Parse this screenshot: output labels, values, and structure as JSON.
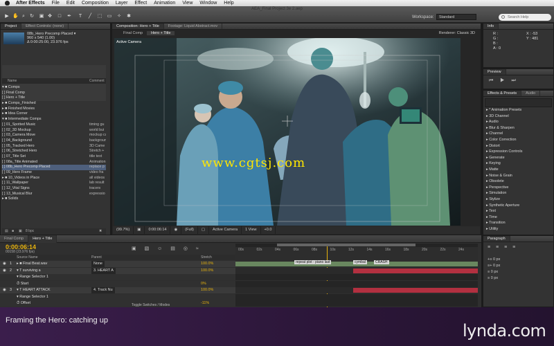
{
  "menubar": {
    "app_name": "After Effects",
    "items": [
      "File",
      "Edit",
      "Composition",
      "Layer",
      "Effect",
      "Animation",
      "View",
      "Window",
      "Help"
    ],
    "window_title": "AEA_Final Project 3e 2.aep"
  },
  "toolbar": {
    "workspace_label": "Workspace:",
    "workspace_value": "Standard",
    "search_placeholder": "Search Help"
  },
  "project_panel": {
    "tabs": [
      "Project",
      "Effect Controls: (none)"
    ],
    "selected_name": "08b_Hero Precomp Placed ▾",
    "selected_dims": "960 x 540 (1.00)",
    "selected_duration": "Δ 0:00:25:00, 23.976 fps",
    "col_name": "Name",
    "col_comment": "Comment",
    "items": [
      {
        "label": "▾ ■ Comps",
        "comment": ""
      },
      {
        "label": "      [ ] Final Comp",
        "comment": ""
      },
      {
        "label": "      [ ] Hero + Title",
        "comment": ""
      },
      {
        "label": "▸ ■ Comps_Finished",
        "comment": ""
      },
      {
        "label": "▸ ■ Finished Movies",
        "comment": ""
      },
      {
        "label": "▸ ■ Idea Corner",
        "comment": ""
      },
      {
        "label": "▾ ■ Intermediate Comps",
        "comment": ""
      },
      {
        "label": "      [ ] 01_Spotted Music",
        "comment": "timing gu"
      },
      {
        "label": "      [ ] 02_3D Mockup",
        "comment": "world bui"
      },
      {
        "label": "      [ ] 03_Camera Move",
        "comment": "mockup ca"
      },
      {
        "label": "      [ ] 04_Background",
        "comment": "backgroun"
      },
      {
        "label": "      [ ] 05_Tracked Hero",
        "comment": "3D Came"
      },
      {
        "label": "      [ ] 06_Stretched Hero",
        "comment": "Stretch +"
      },
      {
        "label": "      [ ] 07_Title Set",
        "comment": "title text"
      },
      {
        "label": "      [ ] 08a_Title Animated",
        "comment": "Animation"
      },
      {
        "label": "      [ ] 08b_Hero Precomp Placed",
        "comment": "replace p"
      },
      {
        "label": "      [ ] 09_Hero Frame",
        "comment": "video fra"
      },
      {
        "label": "  ▸ ■ 10_Videos in Place",
        "comment": "all videos"
      },
      {
        "label": "      [ ] 11_Wallpaper",
        "comment": "lab result"
      },
      {
        "label": "      [ ] 12_Vital Signs",
        "comment": "tracers"
      },
      {
        "label": "      [ ] 13_Musical Blur",
        "comment": "expressio"
      },
      {
        "label": "▸ ■ Solids",
        "comment": ""
      }
    ],
    "bottom_bpc": "8 bpc"
  },
  "composition": {
    "tabs": [
      "Composition: Hero + Title",
      "Footage: Liquid Abstract.mov"
    ],
    "subtabs": [
      "Final Comp",
      "Hero + Title"
    ],
    "renderer": "Renderer:  Classic 3D",
    "view_label": "Active Camera",
    "watermark": "www.cgtsj.com",
    "bottom": [
      "(99.7%)",
      "0:00:06:14",
      "(Full)",
      "Active Camera",
      "1 View",
      "+0.0"
    ]
  },
  "info_panel": {
    "title": "Info",
    "r": "R :",
    "g": "G :",
    "b": "B :",
    "a": "A : 0",
    "x": "X : -53",
    "y": "Y : 481"
  },
  "preview_panel": {
    "title": "Preview"
  },
  "effects_panel": {
    "tabs": [
      "Effects & Presets",
      "Audio"
    ],
    "items": [
      "▸ * Animation Presets",
      "▸ 3D Channel",
      "▸ Audio",
      "▸ Blur & Sharpen",
      "▸ Channel",
      "▸ Color Correction",
      "▸ Distort",
      "▸ Expression Controls",
      "▸ Generate",
      "▸ Keying",
      "▸ Matte",
      "▸ Noise & Grain",
      "▸ Obsolete",
      "▸ Perspective",
      "▸ Simulation",
      "▸ Stylize",
      "▸ Synthetic Aperture",
      "▸ Text",
      "▸ Time",
      "▸ Transition",
      "▸ Utility"
    ]
  },
  "paragraph_panel": {
    "title": "Paragraph",
    "fields": [
      "+≡ 0 px",
      "≡+ 0 px",
      "≡ 0 px",
      "≡ 0 px"
    ]
  },
  "timeline": {
    "tabs": [
      "Final Comp",
      "Hero + Title"
    ],
    "timecode": "0:00:06:14",
    "frames": "00158 (23.976 fps)",
    "columns": {
      "source": "Source Name",
      "parent": "Parent",
      "stretch": "Stretch"
    },
    "layers": [
      {
        "num": "1",
        "name": "▸ ■ Final Beat.wav",
        "parent": "None",
        "stretch": "100.0%"
      },
      {
        "num": "2",
        "name": "▾ T  surviving a",
        "parent": "3. HEART A",
        "stretch": "100.0%"
      },
      {
        "num": "",
        "name": "    ▾ Range Selector 1",
        "parent": "",
        "stretch": ""
      },
      {
        "num": "",
        "name": "        ⏱ Start",
        "parent": "",
        "stretch": "0%"
      },
      {
        "num": "3",
        "name": "▾ T  HEART ATTACK",
        "parent": "4. Track Nu",
        "stretch": "100.0%"
      },
      {
        "num": "",
        "name": "    ▾ Range Selector 1",
        "parent": "",
        "stretch": ""
      },
      {
        "num": "",
        "name": "        ⏱ Offset",
        "parent": "",
        "stretch": "-11%"
      }
    ],
    "ruler_ticks": [
      "00s",
      "02s",
      "04s",
      "06s",
      "08s",
      "10s",
      "12s",
      "14s",
      "16s",
      "18s",
      "20s",
      "22s",
      "24s"
    ],
    "markers": [
      "repeat plot - piano last",
      "cymbal",
      "CRASH"
    ],
    "toggle_label": "Toggle Switches / Modes"
  },
  "footer": {
    "course_title": "Framing the Hero: catching up",
    "brand": "lynda.com"
  },
  "colors": {
    "footer_bg": "#2b1638",
    "keyframe_bar": "#b23040",
    "audio_bar": "#69875f",
    "current_time": "#e8b30d"
  }
}
